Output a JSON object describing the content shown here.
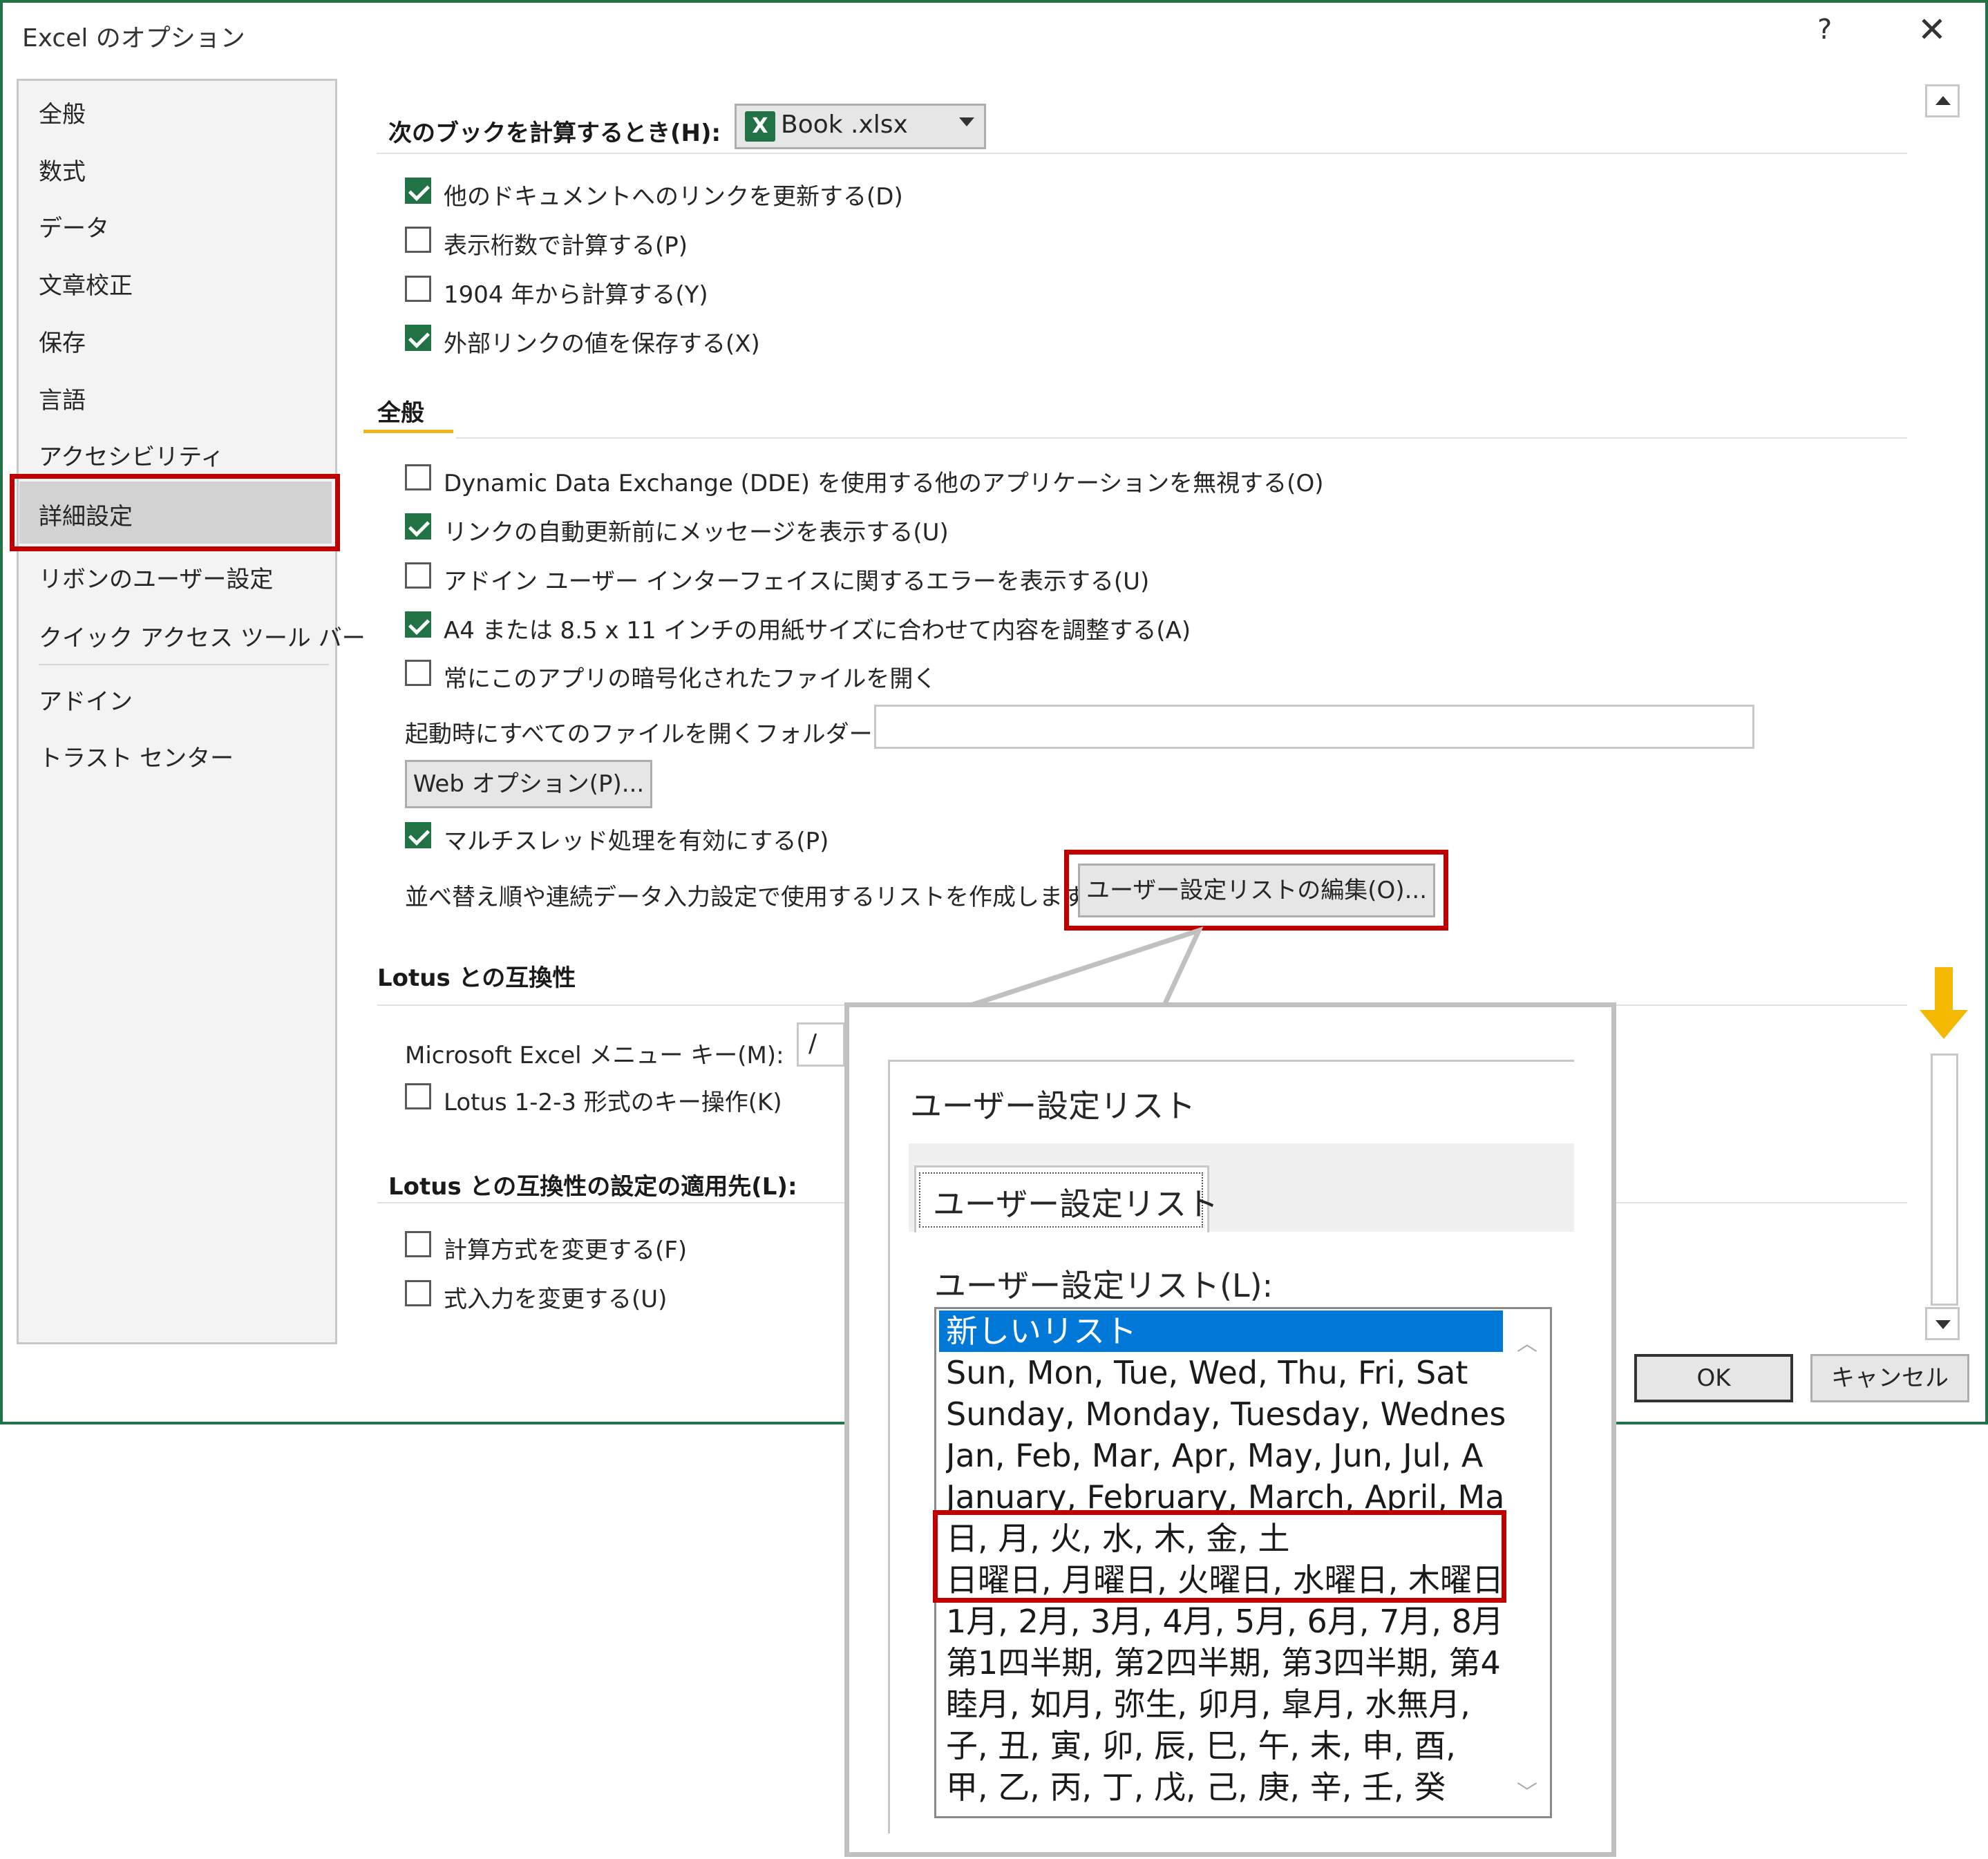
{
  "window": {
    "title": "Excel のオプション",
    "help_label": "?",
    "close_label": "✕",
    "accent": "#217346",
    "highlight": "#c00000"
  },
  "sidebar": {
    "items": [
      {
        "label": "全般"
      },
      {
        "label": "数式"
      },
      {
        "label": "データ"
      },
      {
        "label": "文章校正"
      },
      {
        "label": "保存"
      },
      {
        "label": "言語"
      },
      {
        "label": "アクセシビリティ"
      },
      {
        "label": "詳細設定",
        "selected": true
      },
      {
        "label": "リボンのユーザー設定"
      },
      {
        "label": "クイック アクセス ツール バー"
      },
      {
        "label": "アドイン"
      },
      {
        "label": "トラスト センター"
      }
    ]
  },
  "calc_section": {
    "heading": "次のブックを計算するとき(H):",
    "workbook": "Book .xlsx",
    "workbook_icon": "excel-icon",
    "options": [
      {
        "label": "他のドキュメントへのリンクを更新する(D)",
        "checked": true
      },
      {
        "label": "表示桁数で計算する(P)",
        "checked": false
      },
      {
        "label": "1904 年から計算する(Y)",
        "checked": false
      },
      {
        "label": "外部リンクの値を保存する(X)",
        "checked": true
      }
    ]
  },
  "general_section": {
    "heading": "全般",
    "options": [
      {
        "label": "Dynamic Data Exchange (DDE) を使用する他のアプリケーションを無視する(O)",
        "checked": false
      },
      {
        "label": "リンクの自動更新前にメッセージを表示する(U)",
        "checked": true
      },
      {
        "label": "アドイン ユーザー インターフェイスに関するエラーを表示する(U)",
        "checked": false
      },
      {
        "label": "A4 または 8.5 x 11 インチの用紙サイズに合わせて内容を調整する(A)",
        "checked": true
      },
      {
        "label": "常にこのアプリの暗号化されたファイルを開く",
        "checked": false
      }
    ],
    "startup_folder_label": "起動時にすべてのファイルを開くフォルダー(L):",
    "startup_folder_value": "",
    "web_options_button": "Web オプション(P)...",
    "multithread": {
      "label": "マルチスレッド処理を有効にする(P)",
      "checked": true
    },
    "custom_list_prompt": "並べ替え順や連続データ入力設定で使用するリストを作成します:",
    "edit_custom_lists_button": "ユーザー設定リストの編集(O)..."
  },
  "lotus_section": {
    "heading": "Lotus との互換性",
    "menu_key_label": "Microsoft Excel メニュー キー(M):",
    "menu_key_value": "/",
    "key_nav": {
      "label": "Lotus 1-2-3 形式のキー操作(K)",
      "checked": false
    }
  },
  "lotus_settings_section": {
    "heading": "Lotus との互換性の設定の適用先(L):",
    "options": [
      {
        "label": "計算方式を変更する(F)",
        "checked": false
      },
      {
        "label": "式入力を変更する(U)",
        "checked": false
      }
    ]
  },
  "footer": {
    "ok_label": "OK",
    "cancel_label": "キャンセル"
  },
  "custom_lists_dialog": {
    "title": "ユーザー設定リスト",
    "tab_label": "ユーザー設定リスト",
    "list_label": "ユーザー設定リスト(L):",
    "items": [
      {
        "label": "新しいリスト",
        "selected": true
      },
      {
        "label": "Sun, Mon, Tue, Wed, Thu, Fri, Sat"
      },
      {
        "label": "Sunday, Monday, Tuesday, Wednes"
      },
      {
        "label": "Jan, Feb, Mar, Apr, May, Jun, Jul, A"
      },
      {
        "label": "January, February, March, April, Ma"
      },
      {
        "label": "日, 月, 火, 水, 木, 金, 土"
      },
      {
        "label": "日曜日, 月曜日, 火曜日, 水曜日, 木曜日"
      },
      {
        "label": "1月, 2月, 3月, 4月, 5月, 6月, 7月, 8月"
      },
      {
        "label": "第1四半期, 第2四半期, 第3四半期, 第4"
      },
      {
        "label": "睦月, 如月, 弥生, 卯月, 皐月, 水無月,"
      },
      {
        "label": "子, 丑, 寅, 卯, 辰, 巳, 午, 未, 申, 酉,"
      },
      {
        "label": "甲, 乙, 丙, 丁, 戊, 己, 庚, 辛, 壬, 癸"
      }
    ]
  }
}
